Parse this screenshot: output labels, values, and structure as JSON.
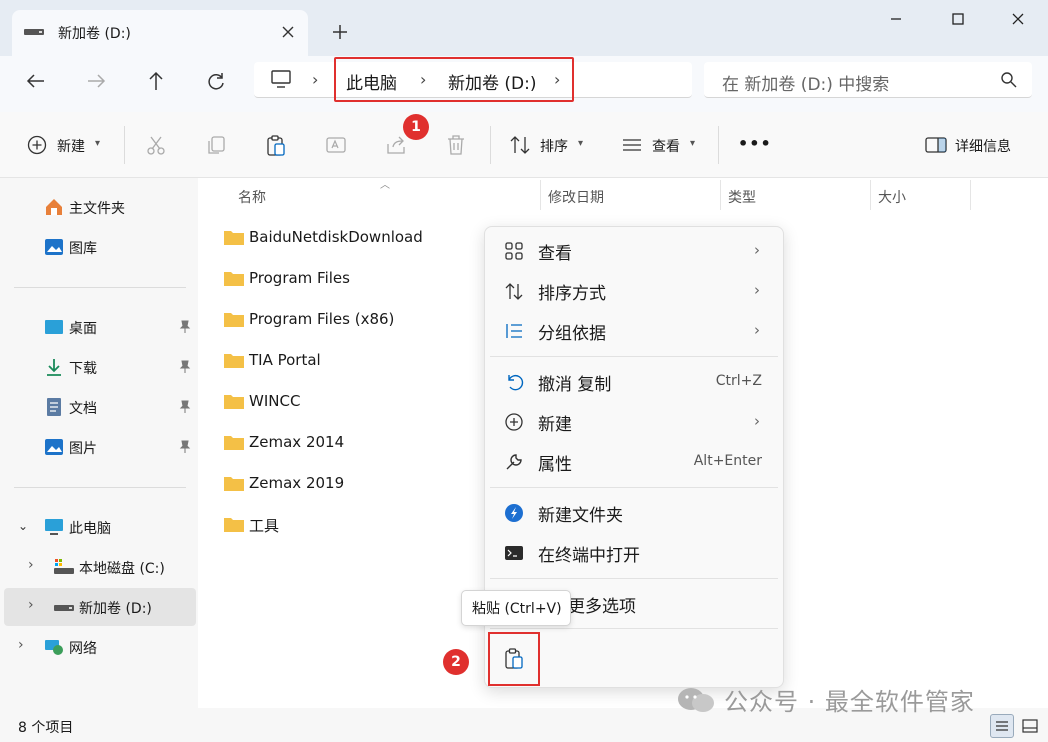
{
  "tab": {
    "title": "新加卷 (D:)"
  },
  "address": {
    "crumbs": [
      "此电脑",
      "新加卷 (D:)"
    ],
    "search_placeholder": "在 新加卷 (D:) 中搜索"
  },
  "toolbar": {
    "new_label": "新建",
    "sort_label": "排序",
    "view_label": "查看",
    "more_label": "•••",
    "details_label": "详细信息"
  },
  "badges": {
    "one": "1",
    "two": "2"
  },
  "sidebar": {
    "items": [
      {
        "label": "主文件夹",
        "icon": "home-icon"
      },
      {
        "label": "图库",
        "icon": "gallery-icon"
      },
      {
        "label": "桌面",
        "icon": "desktop-icon"
      },
      {
        "label": "下载",
        "icon": "download-icon"
      },
      {
        "label": "文档",
        "icon": "document-icon"
      },
      {
        "label": "图片",
        "icon": "pictures-icon"
      },
      {
        "label": "此电脑",
        "icon": "computer-icon"
      },
      {
        "label": "本地磁盘 (C:)",
        "icon": "drive-c-icon"
      },
      {
        "label": "新加卷 (D:)",
        "icon": "drive-d-icon"
      },
      {
        "label": "网络",
        "icon": "network-icon"
      }
    ]
  },
  "columns": [
    "名称",
    "修改日期",
    "类型",
    "大小"
  ],
  "files": [
    "BaiduNetdiskDownload",
    "Program Files",
    "Program Files (x86)",
    "TIA Portal",
    "WINCC",
    "Zemax 2014",
    "Zemax 2019",
    "工具"
  ],
  "context_menu": {
    "items": [
      {
        "label": "查看",
        "shortcut": "",
        "submenu": true
      },
      {
        "label": "排序方式",
        "shortcut": "",
        "submenu": true
      },
      {
        "label": "分组依据",
        "shortcut": "",
        "submenu": true
      },
      {
        "label": "撤消 复制",
        "shortcut": "Ctrl+Z",
        "submenu": false
      },
      {
        "label": "新建",
        "shortcut": "",
        "submenu": true
      },
      {
        "label": "属性",
        "shortcut": "Alt+Enter",
        "submenu": false
      },
      {
        "label": "新建文件夹",
        "shortcut": "",
        "submenu": false
      },
      {
        "label": "在终端中打开",
        "shortcut": "",
        "submenu": false
      },
      {
        "label": "更多选项",
        "shortcut": "",
        "submenu": false
      }
    ],
    "tooltip": "粘贴 (Ctrl+V)"
  },
  "status": {
    "count": "8 个项目"
  },
  "watermark": "公众号 · 最全软件管家",
  "colors": {
    "accent": "#0067c0",
    "highlight": "#e0302e",
    "folder": "#f4c046"
  }
}
